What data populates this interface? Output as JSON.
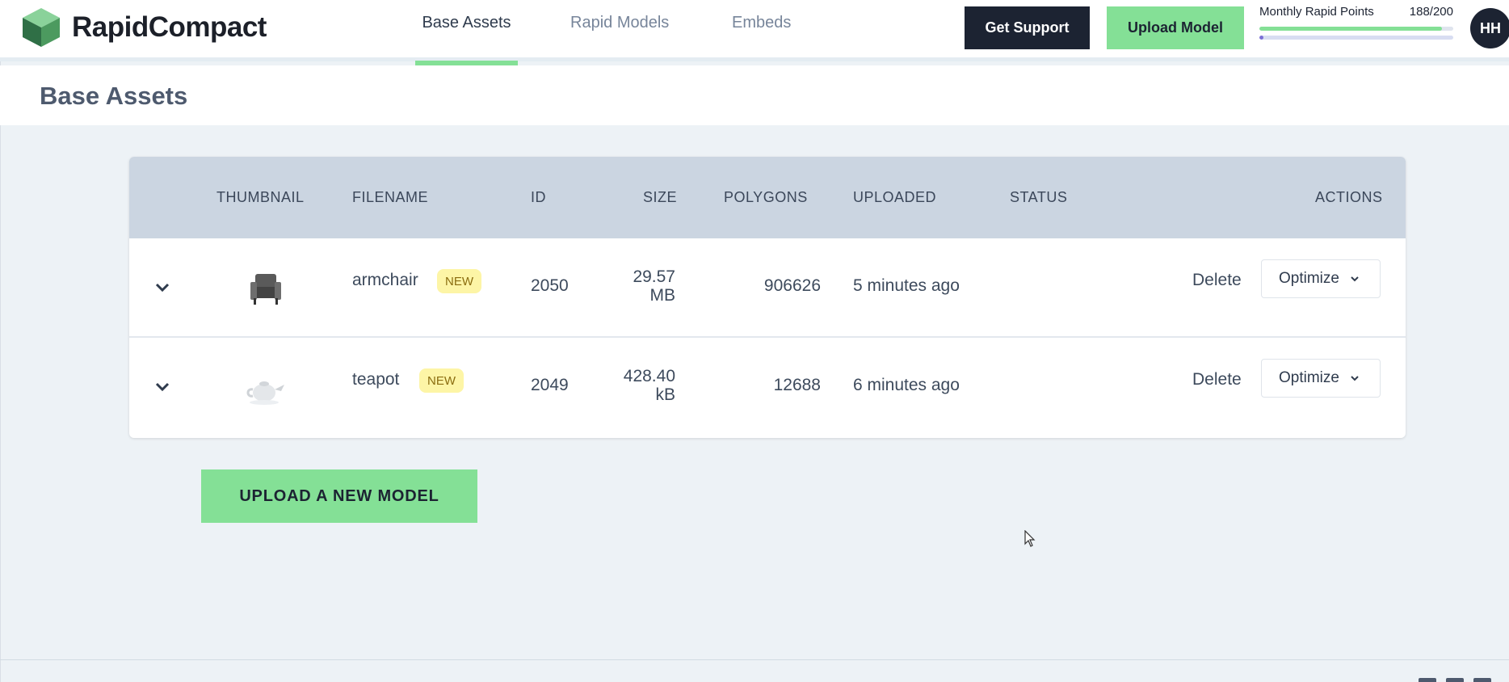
{
  "brand": {
    "name": "RapidCompact",
    "colors": {
      "accent": "#84e096",
      "dark": "#1c2332",
      "cube_dark": "#2f6f46",
      "cube_mid": "#4c9a5f",
      "cube_light": "#8ad29a"
    }
  },
  "nav": {
    "tabs": [
      {
        "label": "Base Assets",
        "active": true
      },
      {
        "label": "Rapid Models",
        "active": false
      },
      {
        "label": "Embeds",
        "active": false
      }
    ]
  },
  "header": {
    "support_label": "Get Support",
    "upload_label": "Upload Model",
    "points_label": "Monthly Rapid Points",
    "points_value": "188/200",
    "points_fraction": 0.94,
    "secondary_fraction": 0.02,
    "avatar_initials": "HH"
  },
  "page": {
    "title": "Base Assets"
  },
  "table": {
    "columns": [
      "THUMBNAIL",
      "FILENAME",
      "ID",
      "SIZE",
      "POLYGONS",
      "UPLOADED",
      "STATUS",
      "ACTIONS"
    ],
    "rows": [
      {
        "thumbnail_icon": "armchair-thumbnail",
        "filename": "armchair",
        "badge": "NEW",
        "id": "2050",
        "size_value": "29.57",
        "size_unit": "MB",
        "polygons": "906626",
        "uploaded": "5 minutes ago",
        "status": "",
        "delete_label": "Delete",
        "optimize_label": "Optimize"
      },
      {
        "thumbnail_icon": "teapot-thumbnail",
        "filename": "teapot",
        "badge": "NEW",
        "id": "2049",
        "size_value": "428.40",
        "size_unit": "kB",
        "polygons": "12688",
        "uploaded": "6 minutes ago",
        "status": "",
        "delete_label": "Delete",
        "optimize_label": "Optimize"
      }
    ]
  },
  "upload_new_label": "UPLOAD A NEW MODEL"
}
